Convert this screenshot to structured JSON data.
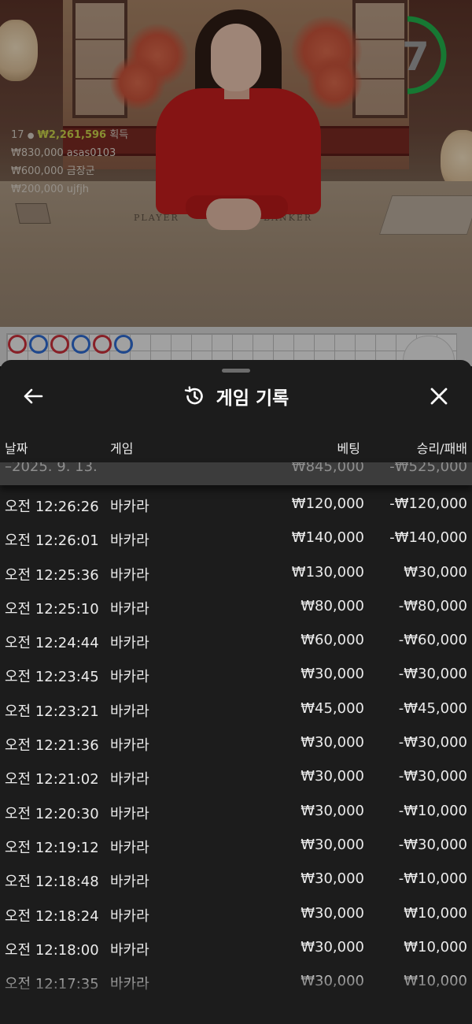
{
  "stream": {
    "timer": "7",
    "timer_color": "#22b14c",
    "table_labels": {
      "player": "PLAYER",
      "banker": "BANKER"
    },
    "players_count": "17",
    "total_win": "₩2,261,596",
    "total_win_suffix": "획득",
    "leaderboard": [
      {
        "amount": "₩830,000",
        "user": "asas0103"
      },
      {
        "amount": "₩600,000",
        "user": "금장군"
      },
      {
        "amount": "₩200,000",
        "user": "ujfjh"
      }
    ]
  },
  "roadmap": {
    "results": [
      "red",
      "blue",
      "red",
      "blue",
      "red",
      "blue"
    ],
    "colors": {
      "red": "#c9303a",
      "blue": "#2e6bd0"
    }
  },
  "sheet": {
    "title": "게임 기록",
    "back_icon": "arrow-left-icon",
    "title_icon": "history-icon",
    "close_icon": "close-icon"
  },
  "columns": {
    "date": "날짜",
    "game": "게임",
    "bet": "베팅",
    "result": "승리/패배"
  },
  "summary": {
    "date": "2025. 9. 13.",
    "bet": "₩845,000",
    "result": "-₩525,000"
  },
  "rows": [
    {
      "time": "오전 12:26:26",
      "game": "바카라",
      "bet": "₩120,000",
      "result": "-₩120,000"
    },
    {
      "time": "오전 12:26:01",
      "game": "바카라",
      "bet": "₩140,000",
      "result": "-₩140,000"
    },
    {
      "time": "오전 12:25:36",
      "game": "바카라",
      "bet": "₩130,000",
      "result": "₩30,000"
    },
    {
      "time": "오전 12:25:10",
      "game": "바카라",
      "bet": "₩80,000",
      "result": "-₩80,000"
    },
    {
      "time": "오전 12:24:44",
      "game": "바카라",
      "bet": "₩60,000",
      "result": "-₩60,000"
    },
    {
      "time": "오전 12:23:45",
      "game": "바카라",
      "bet": "₩30,000",
      "result": "-₩30,000"
    },
    {
      "time": "오전 12:23:21",
      "game": "바카라",
      "bet": "₩45,000",
      "result": "-₩45,000"
    },
    {
      "time": "오전 12:21:36",
      "game": "바카라",
      "bet": "₩30,000",
      "result": "-₩30,000"
    },
    {
      "time": "오전 12:21:02",
      "game": "바카라",
      "bet": "₩30,000",
      "result": "-₩30,000"
    },
    {
      "time": "오전 12:20:30",
      "game": "바카라",
      "bet": "₩30,000",
      "result": "-₩10,000"
    },
    {
      "time": "오전 12:19:12",
      "game": "바카라",
      "bet": "₩30,000",
      "result": "-₩30,000"
    },
    {
      "time": "오전 12:18:48",
      "game": "바카라",
      "bet": "₩30,000",
      "result": "-₩10,000"
    },
    {
      "time": "오전 12:18:24",
      "game": "바카라",
      "bet": "₩30,000",
      "result": "₩10,000"
    },
    {
      "time": "오전 12:18:00",
      "game": "바카라",
      "bet": "₩30,000",
      "result": "₩10,000"
    },
    {
      "time": "오전 12:17:35",
      "game": "바카라",
      "bet": "₩30,000",
      "result": "₩10,000"
    }
  ]
}
